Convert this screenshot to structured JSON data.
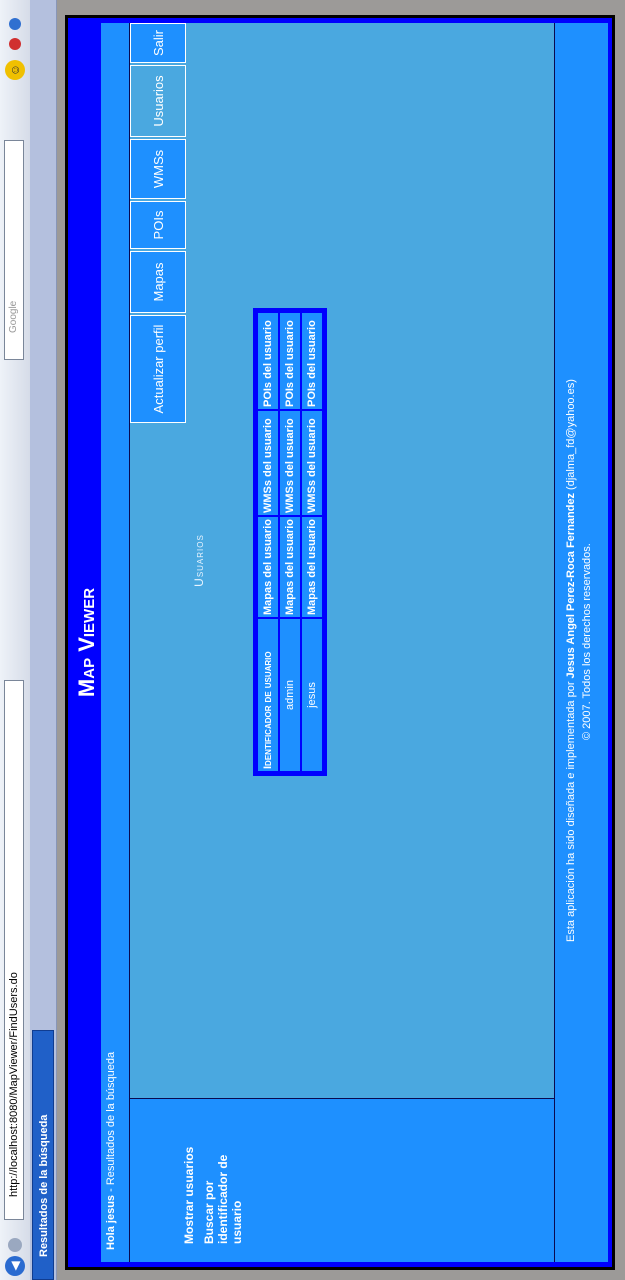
{
  "browser": {
    "url": "http://localhost:8080/MapViewer/FindUsers.do",
    "search_placeholder": "Google",
    "tab_title": "Resultados de la búsqueda"
  },
  "app": {
    "title": "Map Viewer",
    "greeting_prefix": "Hola",
    "user": "jesus",
    "greeting_suffix": " - Resultados de la búsqueda"
  },
  "sidebar": {
    "items": [
      "Mostrar usuarios",
      "Buscar por identificador de usuario"
    ]
  },
  "nav": {
    "tabs": [
      "Salir",
      "Usuarios",
      "WMSs",
      "POIs",
      "Mapas",
      "Actualizar perfil"
    ],
    "active": "Usuarios"
  },
  "main": {
    "section_title": "Usuarios",
    "table_header": "Identificador de usuario",
    "rows": [
      {
        "user": "admin",
        "maps": "Mapas del usuario",
        "wms": "WMSs del usuario",
        "pois": "POIs del usuario"
      },
      {
        "user": "jesus",
        "maps": "Mapas del usuario",
        "wms": "WMSs del usuario",
        "pois": "POIs del usuario"
      }
    ],
    "header_links": {
      "maps": "Mapas del usuario",
      "wms": "WMSs del usuario",
      "pois": "POIs del usuario"
    }
  },
  "footer": {
    "line1_prefix": "Esta aplicación ha sido diseñada e implementada por ",
    "author": "Jesus Angel Perez-Roca Fernandez",
    "email": " (djalma_fd@yahoo.es)",
    "line2": "© 2007. Todos los derechos reservados."
  },
  "colors": {
    "primary": "#0000ff",
    "secondary": "#1e90ff",
    "main_bg": "#4aa8e0"
  }
}
